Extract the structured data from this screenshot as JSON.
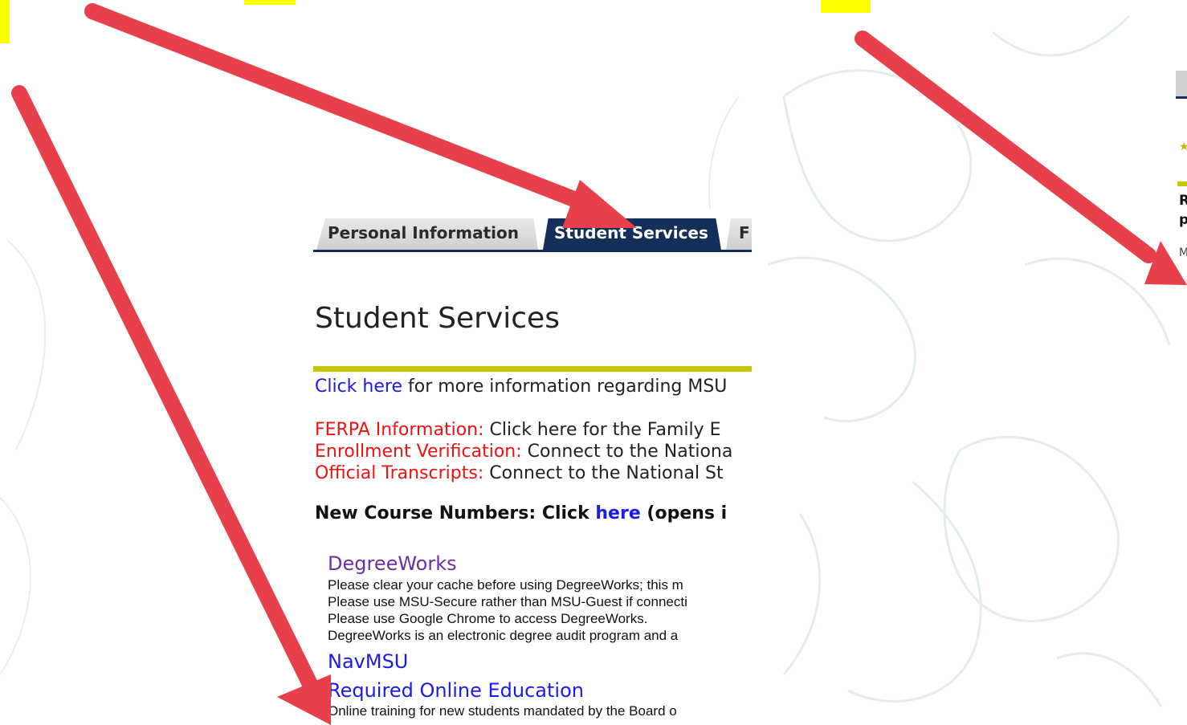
{
  "tabs": {
    "personal": "Personal Information",
    "student": "Student Services",
    "third": "F"
  },
  "page": {
    "title": "Student Services"
  },
  "info": {
    "line1_link": "Click here",
    "line1_text": " for more information regarding MSU",
    "ferpa_label": "FERPA Information:",
    "ferpa_text": " Click here for the Family E",
    "enroll_label": "Enrollment Verification:",
    "enroll_text": " Connect to the Nationa",
    "transcripts_label": "Official Transcripts:",
    "transcripts_text": " Connect to the National St",
    "new_course_a": "New Course Numbers: Click ",
    "new_course_link": "here",
    "new_course_b": " (opens i"
  },
  "services": {
    "degreeworks_title": "DegreeWorks",
    "degreeworks_lines": [
      "Please clear your cache before using DegreeWorks; this m",
      "Please use MSU-Secure rather than MSU-Guest if connecti",
      "Please use Google Chrome to access DegreeWorks.",
      "DegreeWorks is an electronic degree audit program and a"
    ],
    "navmsu_title": "NavMSU",
    "required_title": "Required Online Education",
    "required_desc": "Online training for new students mandated by the Board o"
  },
  "right_panel": {
    "t1": "R",
    "t2": "p",
    "t3": "M"
  },
  "colors": {
    "tab_active": "#14305a",
    "gold_rule": "#c8c800",
    "link": "#1a1aee",
    "alert_red": "#ee1111",
    "visited_purple": "#6a2fa8",
    "annotation_arrow": "#e8404a",
    "highlight": "#ffff00"
  }
}
